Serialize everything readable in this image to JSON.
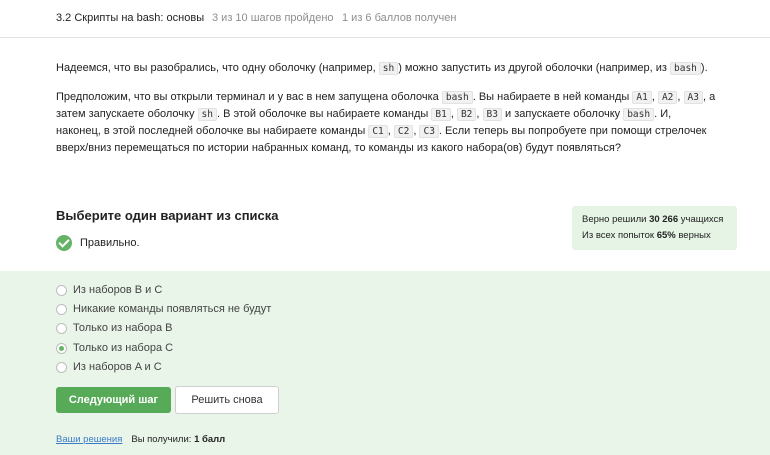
{
  "header": {
    "lesson_title": "3.2 Скрипты на bash: основы",
    "steps_progress": "3 из 10 шагов пройдено",
    "score_progress": "1 из 6 баллов  получен"
  },
  "question": {
    "p1": {
      "t1": "Надеемся, что вы разобрались, что одну оболочку (например,",
      "c1": "sh",
      "t2": ") можно запустить из другой оболочки (например, из",
      "c2": "bash",
      "t3": ")."
    },
    "p2": {
      "t1": "Предположим, что вы открыли терминал и у вас в нем запущена оболочка",
      "c1": "bash",
      "t2": ". Вы набираете в ней команды",
      "c2": "A1",
      "s1": ",",
      "c3": "A2",
      "s2": ",",
      "c4": "A3",
      "t3": ", а затем запускаете оболочку",
      "c5": "sh",
      "t4": ". В этой оболочке вы набираете команды",
      "c6": "B1",
      "s3": ",",
      "c7": "B2",
      "s4": ",",
      "c8": "B3",
      "t5": "и запускаете оболочку",
      "c9": "bash",
      "t6": ". И, наконец, в этой последней оболочке вы набираете команды",
      "c10": "C1",
      "s5": ",",
      "c11": "C2",
      "s6": ",",
      "c12": "C3",
      "t7": ". Если теперь вы попробуете при помощи стрелочек вверх/вниз перемещаться по истории набранных команд, то команды из какого набора(ов) будут появляться?"
    }
  },
  "choose": {
    "heading": "Выберите один вариант из списка",
    "result": "Правильно."
  },
  "stats": {
    "line1_prefix": "Верно решили",
    "line1_count": "30 266",
    "line1_suffix": "учащихся",
    "line2_prefix": "Из всех попыток",
    "line2_percent": "65%",
    "line2_suffix": "верных"
  },
  "options": [
    {
      "label": "Из наборов B и C",
      "checked": false
    },
    {
      "label": "Никакие команды появляться не будут",
      "checked": false
    },
    {
      "label": "Только из набора B",
      "checked": false
    },
    {
      "label": "Только из набора C",
      "checked": true
    },
    {
      "label": "Из наборов A и C",
      "checked": false
    }
  ],
  "buttons": {
    "next": "Следующий шаг",
    "retry": "Решить снова"
  },
  "footer": {
    "solutions_link": "Ваши решения",
    "got_prefix": "Вы получили:",
    "got_value": "1 балл"
  },
  "colors": {
    "accent_green": "#57aa57",
    "panel_bg": "#e9f5e9",
    "link": "#3b7ac7"
  }
}
